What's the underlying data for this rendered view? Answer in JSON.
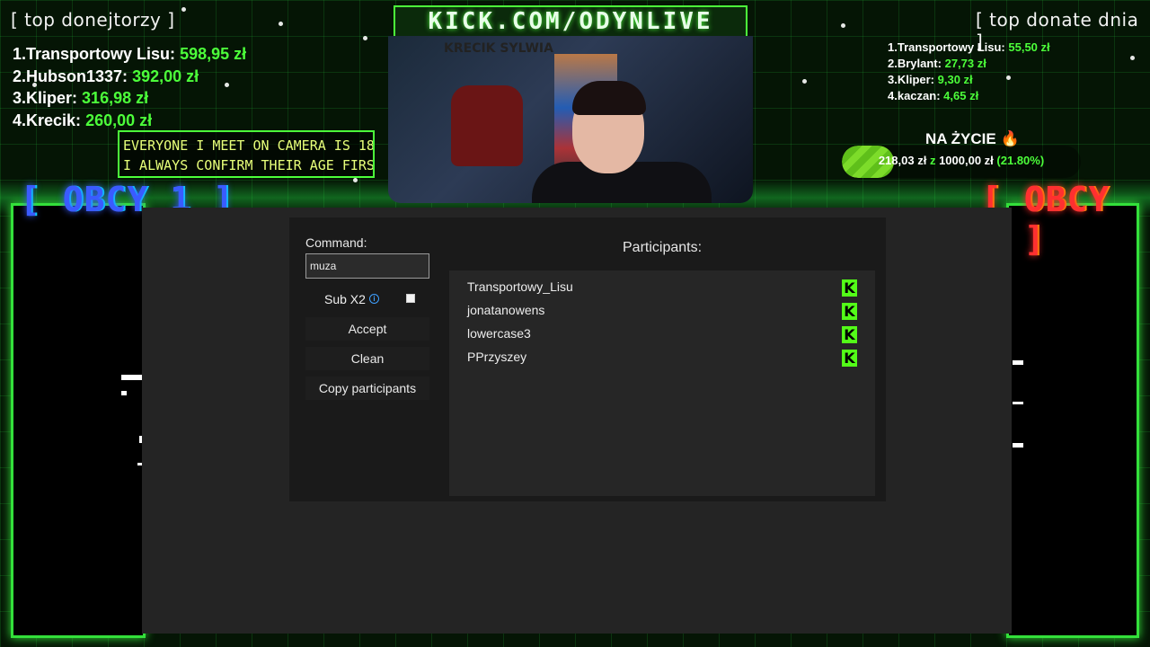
{
  "top_donors": {
    "title": "[ top donejtorzy ]",
    "entries": [
      {
        "rank": "1.",
        "name": "Transportowy Lisu:",
        "amount": "598,95 zł"
      },
      {
        "rank": "2.",
        "name": "Hubson1337:",
        "amount": "392,00 zł"
      },
      {
        "rank": "3.",
        "name": "Kliper:",
        "amount": "316,98 zł"
      },
      {
        "rank": "4.",
        "name": "Krecik:",
        "amount": "260,00 zł"
      }
    ]
  },
  "top_donate_day": {
    "title": "[ top donate dnia ]",
    "entries": [
      {
        "rank": "1.",
        "name": "Transportowy Lisu:",
        "amount": "55,50 zł"
      },
      {
        "rank": "2.",
        "name": "Brylant:",
        "amount": "27,73 zł"
      },
      {
        "rank": "3.",
        "name": "Kliper:",
        "amount": "9,30 zł"
      },
      {
        "rank": "4.",
        "name": "kaczan:",
        "amount": "4,65 zł"
      }
    ]
  },
  "warning": {
    "line1": "EVERYONE I MEET ON CAMERA IS 18+",
    "line2": "I ALWAYS CONFIRM THEIR AGE FIRST!"
  },
  "banner": "KICK.COM/ODYNLIVE",
  "camera_wall_text": "KRECIK SYLWIA",
  "goal": {
    "title": "NA ŻYCIE",
    "icon": "fire-icon",
    "current": "218,03 zł",
    "separator": "z",
    "target": "1000,00 zł",
    "percent_label": "(21.80%)",
    "fraction": 0.218
  },
  "obcy1": "[ OBCY 1 ]",
  "obcy2": "[ OBCY 2 ]",
  "app": {
    "command_label": "Command:",
    "command_value": "muza",
    "sub_label": "Sub X2",
    "sub_checked": false,
    "accept_label": "Accept",
    "clean_label": "Clean",
    "copy_label": "Copy participants",
    "participants_title": "Participants:",
    "participants": [
      {
        "name": "Transportowy_Lisu",
        "icon": "kick-icon"
      },
      {
        "name": "jonatanowens",
        "icon": "kick-icon"
      },
      {
        "name": "lowercase3",
        "icon": "kick-icon"
      },
      {
        "name": "PPrzyszey",
        "icon": "kick-icon"
      }
    ]
  },
  "colors": {
    "accent_green": "#4cff3a",
    "kick_green": "#53fc18",
    "obcy1_blue": "#3a5bff",
    "obcy2_red": "#ff3030",
    "app_bg": "#242424"
  }
}
